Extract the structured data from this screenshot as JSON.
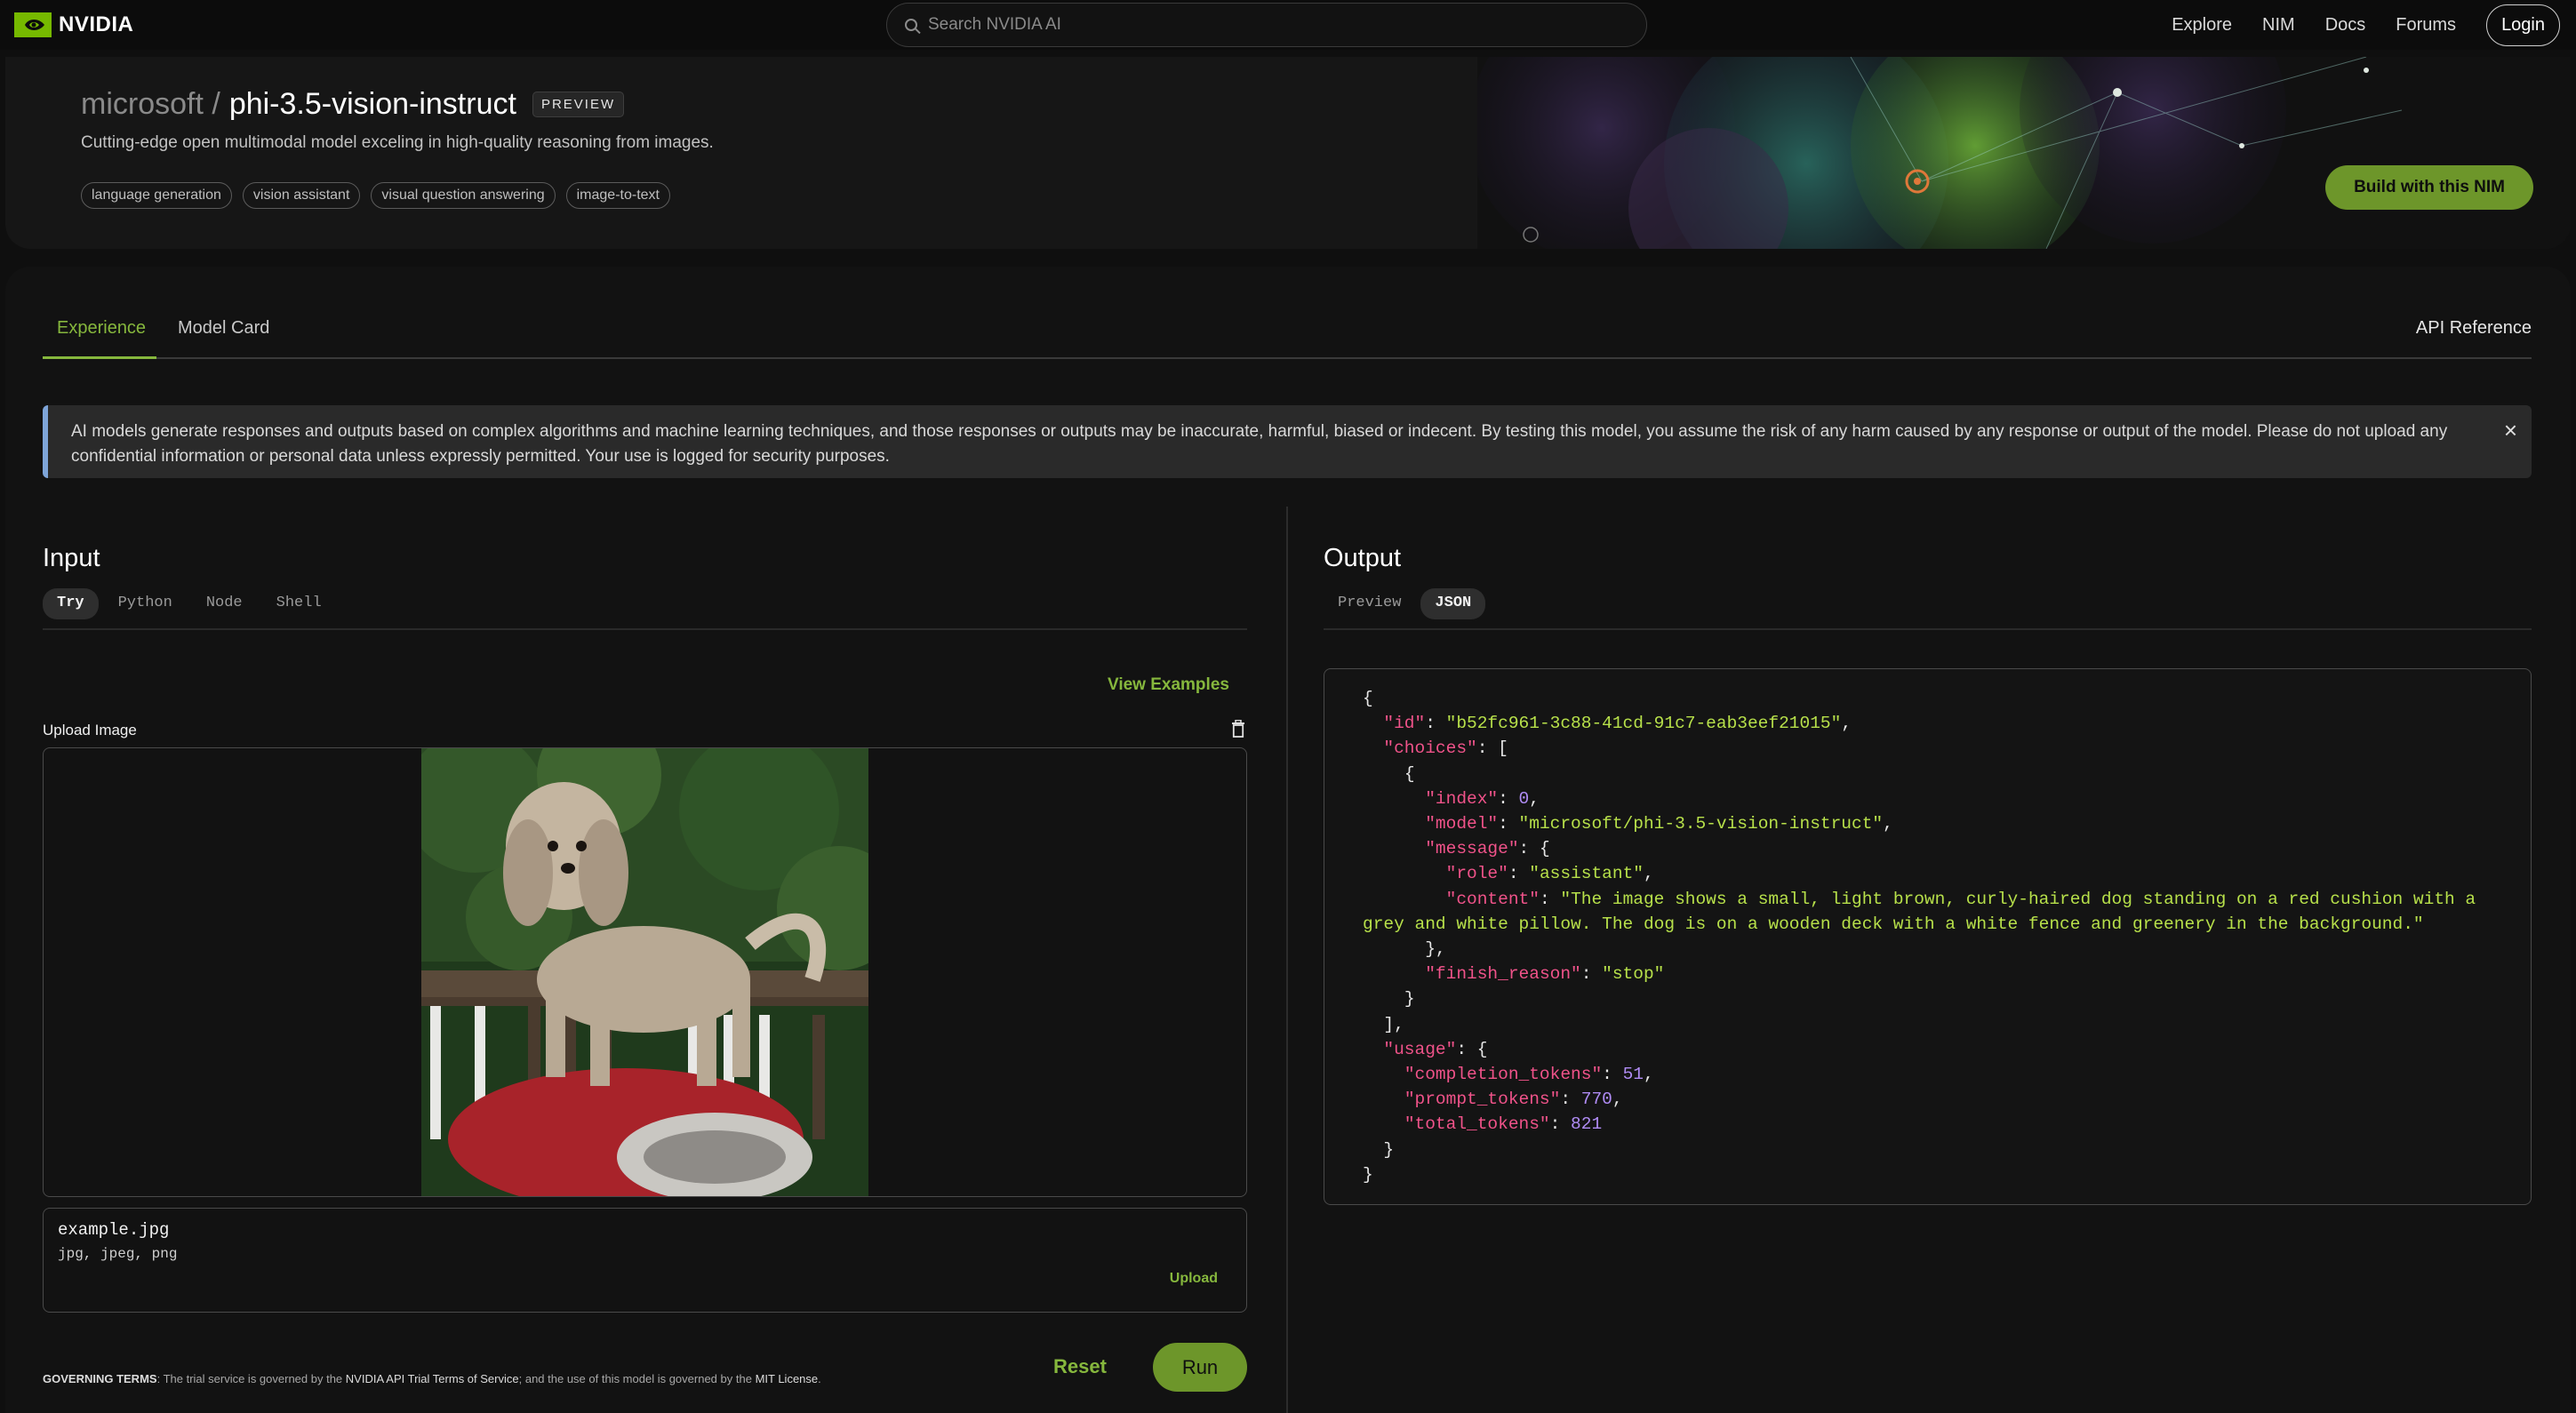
{
  "nav": {
    "brand": "NVIDIA",
    "search_placeholder": "Search NVIDIA AI",
    "links": [
      "Explore",
      "NIM",
      "Docs",
      "Forums"
    ],
    "login": "Login"
  },
  "hero": {
    "org": "microsoft /",
    "model": "phi-3.5-vision-instruct",
    "badge": "PREVIEW",
    "description": "Cutting-edge open multimodal model exceling in high-quality reasoning from images.",
    "tags": [
      "language generation",
      "vision assistant",
      "visual question answering",
      "image-to-text"
    ],
    "build_button": "Build with this NIM"
  },
  "tabs": {
    "items": [
      "Experience",
      "Model Card"
    ],
    "api_reference": "API Reference"
  },
  "notice": {
    "text": "AI models generate responses and outputs based on complex algorithms and machine learning techniques, and those responses or outputs may be inaccurate, harmful, biased or indecent. By testing this model, you assume the risk of any harm caused by any response or output of the model. Please do not upload any confidential information or personal data unless expressly permitted. Your use is logged for security purposes.",
    "close": "×"
  },
  "input": {
    "title": "Input",
    "modes": [
      "Try",
      "Python",
      "Node",
      "Shell"
    ],
    "view_examples": "View Examples",
    "upload_label": "Upload Image",
    "file_name": "example.jpg",
    "file_types": "jpg, jpeg, png",
    "upload_link": "Upload",
    "reset": "Reset",
    "run": "Run",
    "governing": {
      "label": "GOVERNING TERMS",
      "part1": ": The trial service is governed by the ",
      "link1": "NVIDIA API Trial Terms of Service",
      "part2": "; and the use of this model is governed by the ",
      "link2": "MIT License",
      "part3": "."
    }
  },
  "output": {
    "title": "Output",
    "modes": [
      "Preview",
      "JSON"
    ],
    "json": {
      "id": "b52fc961-3c88-41cd-91c7-eab3eef21015",
      "index": "0",
      "model": "microsoft/phi-3.5-vision-instruct",
      "role": "assistant",
      "content": "The image shows a small, light brown, curly-haired dog standing on a red cushion with a grey and white pillow. The dog is on a wooden deck with a white fence and greenery in the background.",
      "finish_reason": "stop",
      "completion_tokens": "51",
      "prompt_tokens": "770",
      "total_tokens": "821"
    }
  },
  "colors": {
    "accent": "#86b73d",
    "button_green": "#6d962a",
    "json_key": "#f0538a",
    "json_string": "#b7e04a",
    "json_number": "#b08cf5",
    "notice_border": "#7ea5d9"
  },
  "icons": [
    "search-icon",
    "nvidia-eye-icon",
    "close-icon",
    "trash-icon"
  ]
}
